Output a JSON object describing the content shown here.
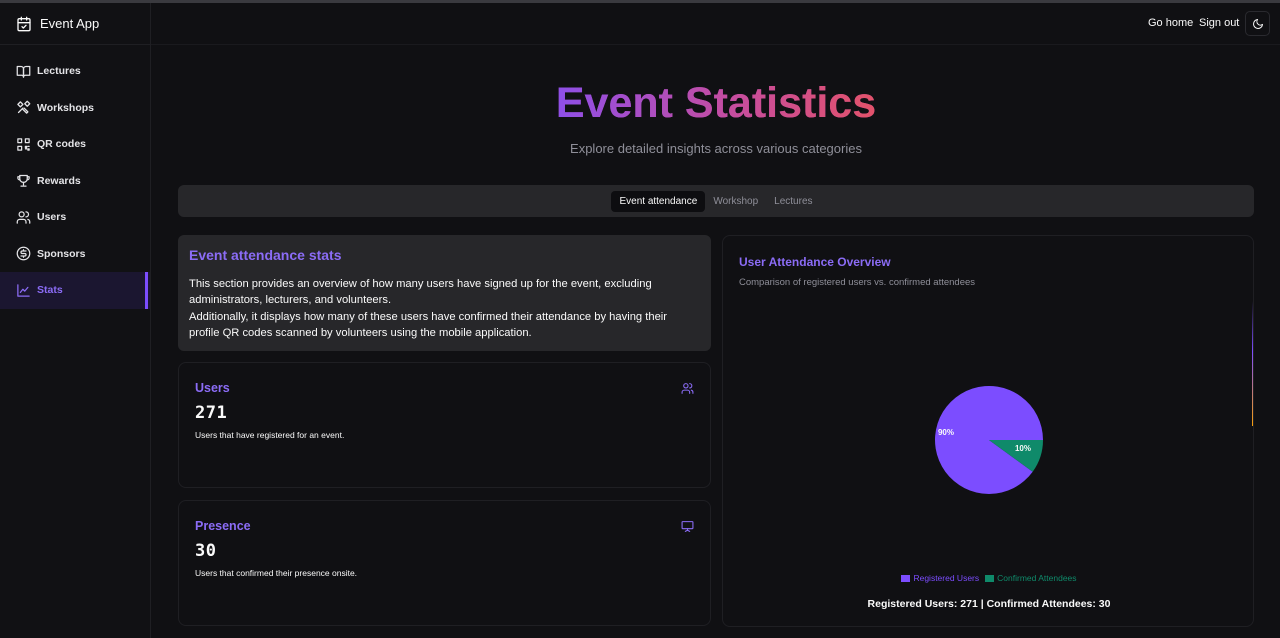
{
  "app": {
    "name": "Event App"
  },
  "sidebar": {
    "items": [
      {
        "label": "Lectures",
        "icon": "book-open-icon"
      },
      {
        "label": "Workshops",
        "icon": "tools-icon"
      },
      {
        "label": "QR codes",
        "icon": "qr-code-icon"
      },
      {
        "label": "Rewards",
        "icon": "trophy-icon"
      },
      {
        "label": "Users",
        "icon": "users-icon"
      },
      {
        "label": "Sponsors",
        "icon": "dollar-circle-icon"
      },
      {
        "label": "Stats",
        "icon": "line-chart-icon",
        "active": true
      }
    ]
  },
  "header": {
    "go_home": "Go home",
    "sign_out": "Sign out",
    "theme_icon": "moon-icon"
  },
  "hero": {
    "title": "Event Statistics",
    "subtitle": "Explore detailed insights across various categories"
  },
  "tabs": [
    {
      "label": "Event attendance",
      "active": true
    },
    {
      "label": "Workshop"
    },
    {
      "label": "Lectures"
    }
  ],
  "info": {
    "title": "Event attendance stats",
    "line1": "This section provides an overview of how many users have signed up for the event, excluding administrators, lecturers, and volunteers.",
    "line2": "Additionally, it displays how many of these users have confirmed their attendance by having their profile QR codes scanned by volunteers using the mobile application."
  },
  "cards": {
    "users": {
      "title": "Users",
      "value": "271",
      "description": "Users that have registered for an event.",
      "icon": "users-icon"
    },
    "presence": {
      "title": "Presence",
      "value": "30",
      "description": "Users that confirmed their presence onsite.",
      "icon": "presentation-icon"
    }
  },
  "chart": {
    "title": "User Attendance Overview",
    "subtitle": "Comparison of registered users vs. confirmed attendees",
    "summary": "Registered Users: 271 | Confirmed Attendees: 30"
  },
  "colors": {
    "accent": "#7c4dff",
    "registered": "#7c4dff",
    "confirmed": "#0f8a6a"
  },
  "chart_data": {
    "type": "pie",
    "title": "User Attendance Overview",
    "subtitle": "Comparison of registered users vs. confirmed attendees",
    "labels": [
      "Registered Users",
      "Confirmed Attendees"
    ],
    "values": [
      90,
      10
    ],
    "value_labels": [
      "90%",
      "10%"
    ],
    "colors": [
      "#7c4dff",
      "#0f8a6a"
    ],
    "legend": "bottom"
  }
}
